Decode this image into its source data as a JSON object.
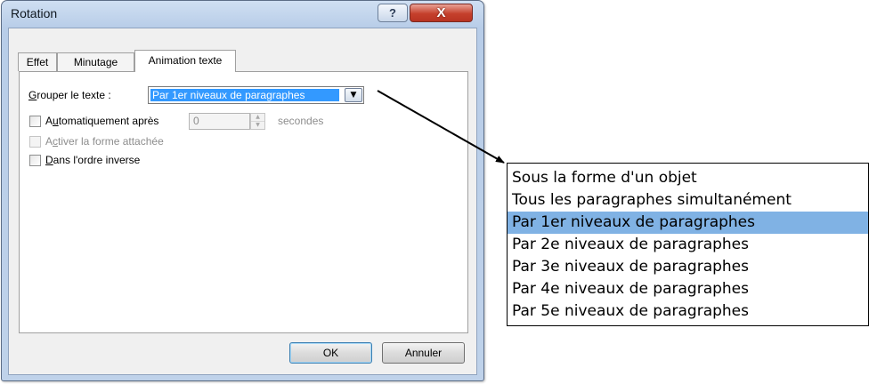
{
  "dialog": {
    "title": "Rotation",
    "help_glyph": "?",
    "close_glyph": "X",
    "tabs": [
      {
        "label": "Effet"
      },
      {
        "label": "Minutage"
      },
      {
        "label": "Animation texte"
      }
    ],
    "group_label_accel": "G",
    "group_label_rest": "rouper le texte :",
    "group_value": "Par 1er niveaux de paragraphes",
    "auto_after": {
      "label_pre": "A",
      "label_accel": "u",
      "label_post": "tomatiquement après",
      "value": "0",
      "unit": "secondes",
      "checked": false
    },
    "attached_shape": {
      "label_pre": "A",
      "label_accel": "c",
      "label_post": "tiver la forme attachée",
      "checked": false
    },
    "reverse_order": {
      "label_accel": "D",
      "label_post": "ans l'ordre inverse",
      "checked": false
    },
    "ok_label": "OK",
    "cancel_label": "Annuler"
  },
  "dropdown": {
    "selected_index": 2,
    "options": [
      "Sous la forme d'un objet",
      "Tous les paragraphes simultanément",
      "Par 1er niveaux de paragraphes",
      "Par 2e niveaux de paragraphes",
      "Par 3e niveaux de paragraphes",
      "Par 4e niveaux de paragraphes",
      "Par 5e niveaux de paragraphes"
    ]
  },
  "colors": {
    "selection_dialog": "#3399ff",
    "selection_list": "#80b2e4",
    "close_button": "#c5402c",
    "titlebar": "#b8cde8"
  }
}
